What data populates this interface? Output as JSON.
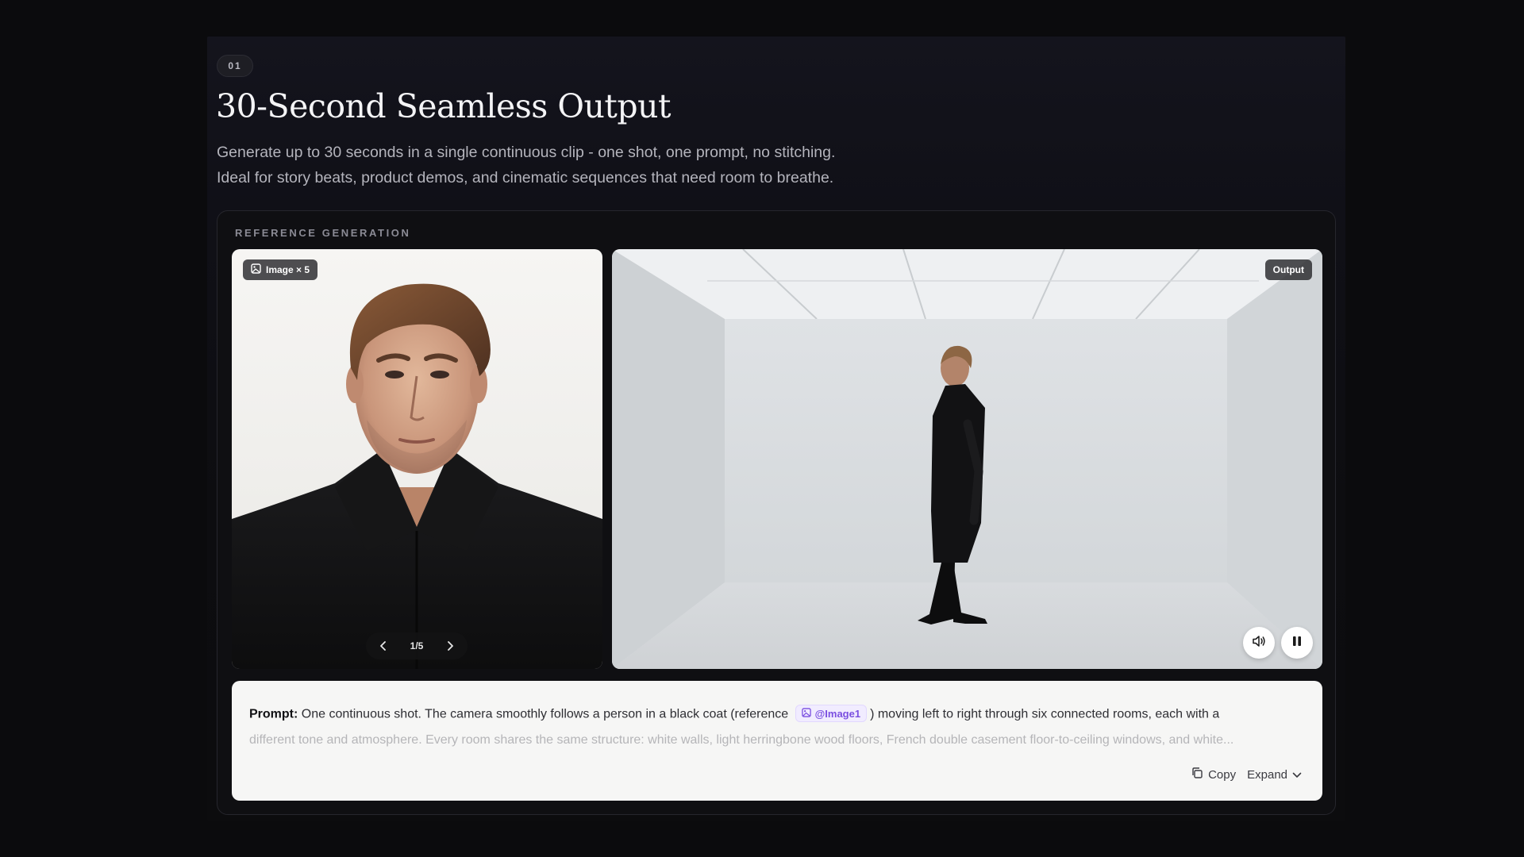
{
  "section": {
    "number": "01",
    "title": "30-Second Seamless Output",
    "subtitle_lines": [
      "Generate up to 30 seconds in a single continuous clip - one shot, one prompt, no stitching.",
      "Ideal for story beats, product demos, and cinematic sequences that need room to breathe."
    ]
  },
  "card": {
    "label": "REFERENCE GENERATION",
    "reference": {
      "chip_label": "Image × 5",
      "chip_icon": "image-icon",
      "pager": "1/5",
      "prev_icon": "chevron-left-icon",
      "next_icon": "chevron-right-icon"
    },
    "output": {
      "chip_label": "Output",
      "controls": [
        "volume-icon",
        "pause-icon"
      ]
    },
    "prompt": {
      "label": "Prompt:",
      "text_before": "One continuous shot. The camera smoothly follows a person in a black coat (reference",
      "mention": "@Image1",
      "text_after": ") moving left to right through six connected rooms, each with a",
      "line2": "different tone and atmosphere. Every room shares the same structure: white walls, light herringbone wood floors, French double casement floor-to-ceiling windows, and white...",
      "copy_label": "Copy",
      "expand_label": "Expand"
    }
  },
  "colors": {
    "page_bg": "#0b0b0d",
    "mention_text": "#7a4fe0",
    "mention_bg": "#f1ecff"
  }
}
